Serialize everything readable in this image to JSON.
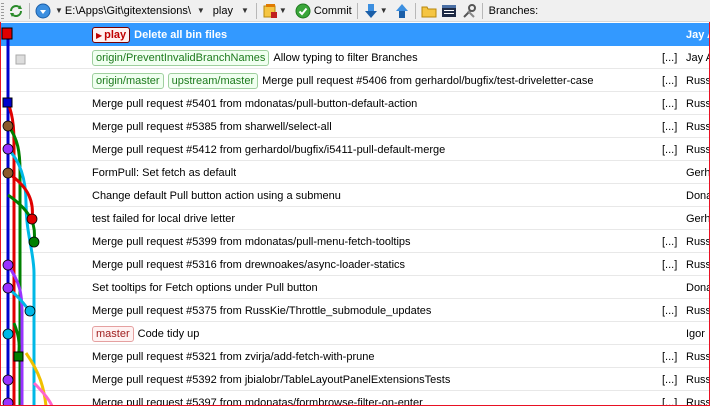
{
  "toolbar": {
    "path": "E:\\Apps\\Git\\gitextensions\\",
    "branch": "play",
    "commit_label": "Commit",
    "branches_label": "Branches:",
    "icons": [
      "refresh-icon",
      "browse-icon",
      "dashboard-icon",
      "commit-check-icon",
      "pull-icon",
      "push-icon",
      "folder-icon",
      "console-icon",
      "settings-icon"
    ]
  },
  "commits": [
    {
      "refs": [
        {
          "name": "play",
          "kind": "head"
        }
      ],
      "message": "Delete all bin files",
      "dots": "",
      "author": "Jay A",
      "selected": true
    },
    {
      "refs": [
        {
          "name": "origin/PreventInvalidBranchNames",
          "kind": "remote"
        }
      ],
      "message": "Allow typing to filter Branches",
      "dots": "[...]",
      "author": "Jay A"
    },
    {
      "refs": [
        {
          "name": "origin/master",
          "kind": "remote"
        },
        {
          "name": "upstream/master",
          "kind": "remote"
        }
      ],
      "message": "Merge pull request #5406 from gerhardol/bugfix/test-driveletter-case",
      "dots": "[...]",
      "author": "Russ"
    },
    {
      "refs": [],
      "message": "Merge pull request #5401 from mdonatas/pull-button-default-action",
      "dots": "[...]",
      "author": "Russ"
    },
    {
      "refs": [],
      "message": "Merge pull request #5385 from sharwell/select-all",
      "dots": "[...]",
      "author": "Russ"
    },
    {
      "refs": [],
      "message": "Merge pull request #5412 from gerhardol/bugfix/i5411-pull-default-merge",
      "dots": "[...]",
      "author": "Russ"
    },
    {
      "refs": [],
      "message": "FormPull: Set fetch as default",
      "dots": "",
      "author": "Gerh"
    },
    {
      "refs": [],
      "message": "Change default Pull button action using a submenu",
      "dots": "",
      "author": "Dona"
    },
    {
      "refs": [],
      "message": "test failed for local drive letter",
      "dots": "",
      "author": "Gerh"
    },
    {
      "refs": [],
      "message": "Merge pull request #5399 from mdonatas/pull-menu-fetch-tooltips",
      "dots": "[...]",
      "author": "Russ"
    },
    {
      "refs": [],
      "message": "Merge pull request #5316 from drewnoakes/async-loader-statics",
      "dots": "[...]",
      "author": "Russ"
    },
    {
      "refs": [],
      "message": "Set tooltips for Fetch options under Pull button",
      "dots": "",
      "author": "Dona"
    },
    {
      "refs": [],
      "message": "Merge pull request #5375 from RussKie/Throttle_submodule_updates",
      "dots": "[...]",
      "author": "Russ"
    },
    {
      "refs": [
        {
          "name": "master",
          "kind": "local"
        }
      ],
      "message": "Code tidy up",
      "dots": "",
      "author": "Igor"
    },
    {
      "refs": [],
      "message": "Merge pull request #5321 from zvirja/add-fetch-with-prune",
      "dots": "[...]",
      "author": "Russ"
    },
    {
      "refs": [],
      "message": "Merge pull request #5392 from jbialobr/TableLayoutPanelExtensionsTests",
      "dots": "[...]",
      "author": "Russ"
    },
    {
      "refs": [],
      "message": "Merge pull request #5397 from mdonatas/formbrowse-filter-on-enter",
      "dots": "[...]",
      "author": "Russ"
    }
  ],
  "graph_colors": {
    "red": "#e00000",
    "blue": "#0000cc",
    "green": "#008000",
    "cyan": "#00b8e6",
    "purple": "#9933ff",
    "brown": "#8b5a2b",
    "yellow": "#f0c000",
    "pink": "#ff66cc",
    "selection": "#3399ff"
  }
}
